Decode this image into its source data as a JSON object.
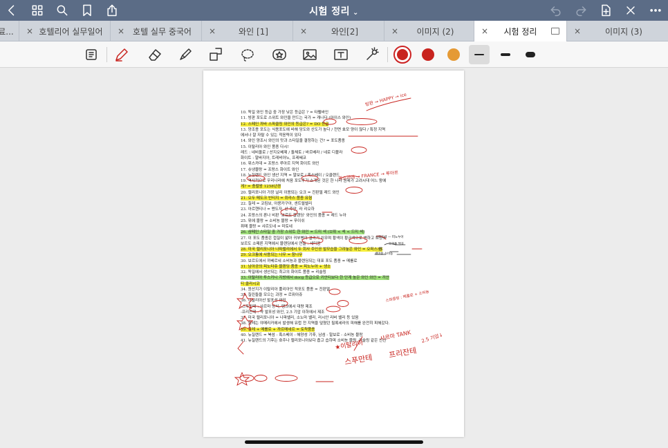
{
  "window": {
    "title": "시험 정리",
    "title_chevron": "⌄"
  },
  "tabs": [
    {
      "label": "료...",
      "active": false
    },
    {
      "label": "호텔리어 실무일어",
      "active": false
    },
    {
      "label": "호텔 실무 중국어",
      "active": false
    },
    {
      "label": "와인 [1]",
      "active": false
    },
    {
      "label": "와인[2]",
      "active": false
    },
    {
      "label": "이미지 (2)",
      "active": false
    },
    {
      "label": "시험 정리",
      "active": true
    },
    {
      "label": "이미지 (3)",
      "active": false
    }
  ],
  "tab_close_glyph": "×",
  "colors": {
    "titlebar": "#5b6c86",
    "pen_red": "#c8231e",
    "orange": "#e59a35",
    "highlight_yellow": "#f6ee3a",
    "highlight_green": "#9fe07a"
  },
  "document": {
    "lines": [
      "10. 독일 와인 등급 중 가장 낮은 등급은 ? = 타펠바인",
      "11. 빙판 포도로 스위트 와인을 만드는 국가 = 캐나다 (아이스 와인)",
      "12. 스페인 까바 스파클링 와인의 등급은? = DO 등급",
      "13. 양조용 포도는 식용포도에 비해 당도와 산도가 높다 / 전면 효모 양이 많다 / 특정 지역",
      "에서나 잘 자랄 수 있는 적응력이 있다",
      "14. 와인 양조시 와인의 맛과 스타일을 결정하는 건? = 포도품종",
      "15. 이탈리아 와인 품종 다시!",
      "레드 : 네비올로 / 산지오베제 / 돌체토 / 바르베라 / 네로 디볼라",
      "화이트 : 말바지아, 트레비아노, 프레쎄코",
      "16. 뮈스카데 = 프랑스 루아르 지역 화이트 와인",
      "17. 슈냉블랑 = 프랑스 화이트 와인",
      "18. 뉴질랜드 와인 생산 지역 = 말보로 / 혹스베이 / 오클랜드",
      "19. 역사적으로 우리나라에 처음 포도주가 소개된 것은 한 나라 원제가 고려시대 어느 왕에",
      "게? = 충렬왕 1258년경",
      "20. 캘리포니아 가장 널리 이용되는 오크 = 진판델 레드 와인",
      "21. 오두 메도크 빈티지 = 쥐라스 품종 유형",
      "22. 칠레 = 코킴보, 아콩카구아, 센트럴벨리",
      "23. 아르헨티나 = 멘도자, 산 후안, 라 리오하",
      "24. 프랑스의 론나 비판 '보르도 블렌딩' 와인의 품종 = 레드 누아",
      "25. 뮈에 블랑 = 소비뇽 블랑 = 푸이쉬",
      "     퓌메 블랑 = 샤르도네 = 미토네",
      "26. 샴페인 스타일 중 가장 스위트 한 와인 = 드미 섹 (브뤼 < 섹 < 드미 섹)",
      "27.    이 포도 품종은 껍질이 얇아 귀부병이 걸리기 쉬우며 황색이 황금색으로 변하고 프랑스",
      "보르도 소떼른 지역에서 블렌딩에서 연들 : 세미용",
      "28. 미국 캘리포니아 나파밸리에서 두 회사 주인공 발모습을 그려놓은 와인 = 오퍼스 원",
      "29. 오크통에 사용되는 나무 = 참나무",
      "30. 보르도에서 까베르네 소비뇽과 블렌딩되는 대표 포도 품종 = 메를로",
      "31. 남아공의 피노타쥬 블렌딩 품종 = 피노누아 + 생소",
      "32. 독일에서 생산되는 최고의 화이트 품종 = 리슬링",
      "33. 이탈리아 투스카니 지방에서 docg 등급으로 키안티보다 한 단계 높은 와인 와인 = 끼안",
      "티 클라시코",
      "34. 원산지가 이탈리아 풀리아인 적포도 품종 = 진판델",
      "35. 칠린들을 모으는 과정 = 르뮈아쥬",
      "36. 이탈리아산 발포성 와인",
      "-스푸만테 : 샤르마 방식, 탱크에서 대량 제조",
      "-프리잔테 : 약 발포성 와인, 2.5 기압 이하에서 제조",
      "37. 미국 캘리포니아 = 나파밸리, 소노마 밸리, 러시안 리버 밸리 등 있음",
      "38. 필레는 야메리카에서 발생해 유럽 전 지역을 덮쳤던 필록세라의 피해를 완전히 피해갔다.",
      "39. 칠레 + 메를로 + 까르메네르 = 토착품종",
      "40. 뉴질랜드 = 북섬 - 혹스베이 - 해양성 기후, 남섬 - 말보로 - 소비뇽 블랑",
      "41. 뉴질랜드의 기후는    호주나 캘리포니아보다 춥고 습하며 소비뇽 블랑, 리슬링 같은 신선"
    ],
    "annotations": [
      "빙판 → HAPPY → ice",
      "뮈스카데 → FRANCE → 루아르",
      "샤르도네 — 피노누아",
      "오크통 발효",
      "레드",
      "세미용 소비뇽",
      "스파클링 : 메를로 + 소비뇽",
      "★이탈리아",
      "샤르마 TANK",
      "2.5 기압↓",
      "스푸만테",
      "프리잔테"
    ]
  }
}
